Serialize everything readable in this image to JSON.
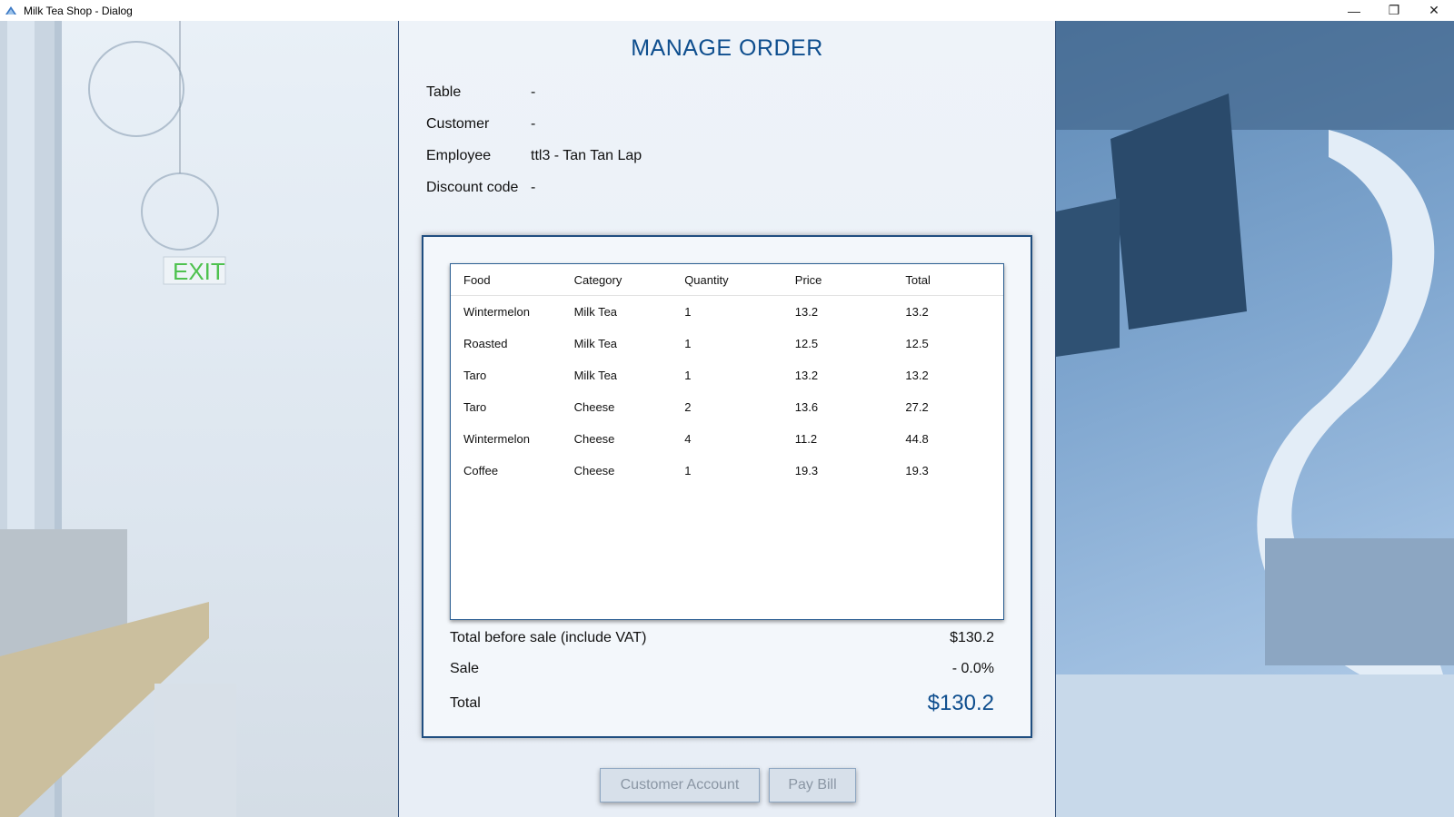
{
  "window": {
    "title": "Milk Tea Shop - Dialog",
    "minimize": "—",
    "restore": "❐",
    "close": "✕"
  },
  "header": {
    "title": "MANAGE ORDER"
  },
  "info": [
    {
      "label": "Table",
      "value": "-"
    },
    {
      "label": "Customer",
      "value": "-"
    },
    {
      "label": "Employee",
      "value": "ttl3 - Tan Tan Lap"
    },
    {
      "label": "Discount code",
      "value": "-"
    }
  ],
  "table": {
    "columns": [
      "Food",
      "Category",
      "Quantity",
      "Price",
      "Total"
    ],
    "rows": [
      [
        "Wintermelon",
        "Milk Tea",
        "1",
        "13.2",
        "13.2"
      ],
      [
        "Roasted",
        "Milk Tea",
        "1",
        "12.5",
        "12.5"
      ],
      [
        "Taro",
        "Milk Tea",
        "1",
        "13.2",
        "13.2"
      ],
      [
        "Taro",
        "Cheese",
        "2",
        "13.6",
        "27.2"
      ],
      [
        "Wintermelon",
        "Cheese",
        "4",
        "11.2",
        "44.8"
      ],
      [
        "Coffee",
        "Cheese",
        "1",
        "19.3",
        "19.3"
      ]
    ]
  },
  "summary": {
    "before_label": "Total before sale (include VAT)",
    "before_value": "$130.2",
    "sale_label": "Sale",
    "sale_value": "- 0.0%",
    "total_label": "Total",
    "total_value": "$130.2"
  },
  "buttons": {
    "customer_account": "Customer Account",
    "pay_bill": "Pay Bill"
  },
  "colors": {
    "accent": "#0e4e8e",
    "panel_border": "#1f4e80"
  }
}
